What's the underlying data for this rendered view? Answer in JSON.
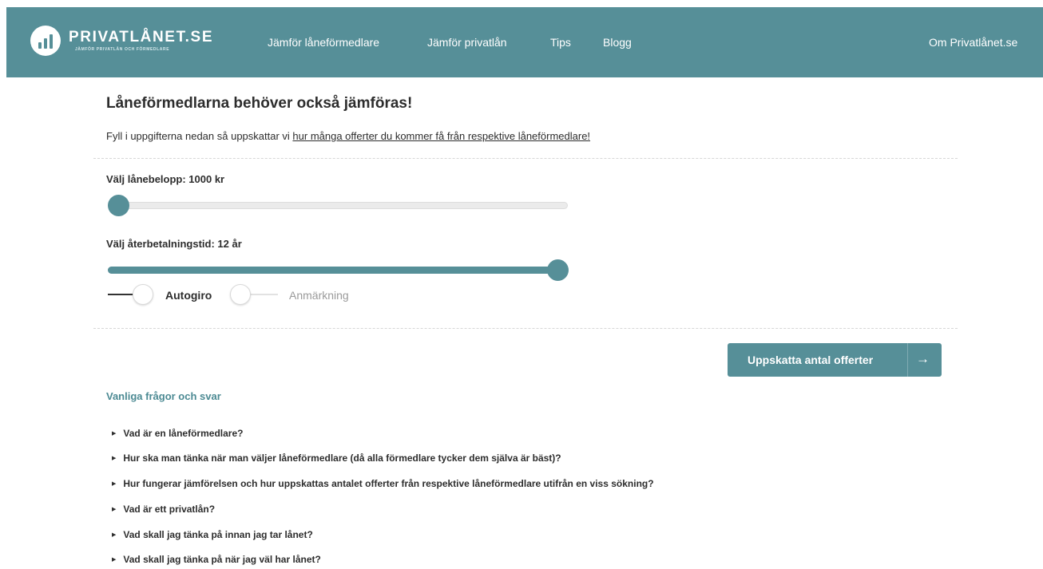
{
  "brand": {
    "name": "PRIVATLÅNET.SE",
    "tagline": "JÄMFÖR PRIVATLÅN OCH FÖRMEDLARE",
    "color": "#568f98"
  },
  "nav": {
    "items": [
      "Jämför låneförmedlare",
      "Jämför privatlån",
      "Tips",
      "Blogg"
    ],
    "right": "Om Privatlånet.se"
  },
  "main": {
    "title": "Låneförmedlarna behöver också jämföras!",
    "intro_prefix": "Fyll i uppgifterna nedan så uppskattar vi ",
    "intro_link": "hur många offerter du kommer få från respektive låneförmedlare!"
  },
  "loan_amount": {
    "label": "Välj lånebelopp: 1000 kr",
    "fraction": 0.0
  },
  "repayment": {
    "label": "Välj återbetalningstid: 12 år",
    "fraction": 1.0
  },
  "toggles": [
    {
      "label": "Autogiro",
      "on": true
    },
    {
      "label": "Anmärkning",
      "on": false
    }
  ],
  "cta": {
    "label": "Uppskatta antal offerter",
    "icon": "arrow-right-icon"
  },
  "faq": {
    "title": "Vanliga frågor och svar",
    "items": [
      "Vad är en låneförmedlare?",
      "Hur ska man tänka när man väljer låneförmedlare (då alla förmedlare tycker dem själva är bäst)?",
      "Hur fungerar jämförelsen och hur uppskattas antalet offerter från respektive låneförmedlare utifrån en viss sökning?",
      "Vad är ett privatlån?",
      "Vad skall jag tänka på innan jag tar lånet?",
      "Vad skall jag tänka på när jag väl har lånet?"
    ]
  }
}
